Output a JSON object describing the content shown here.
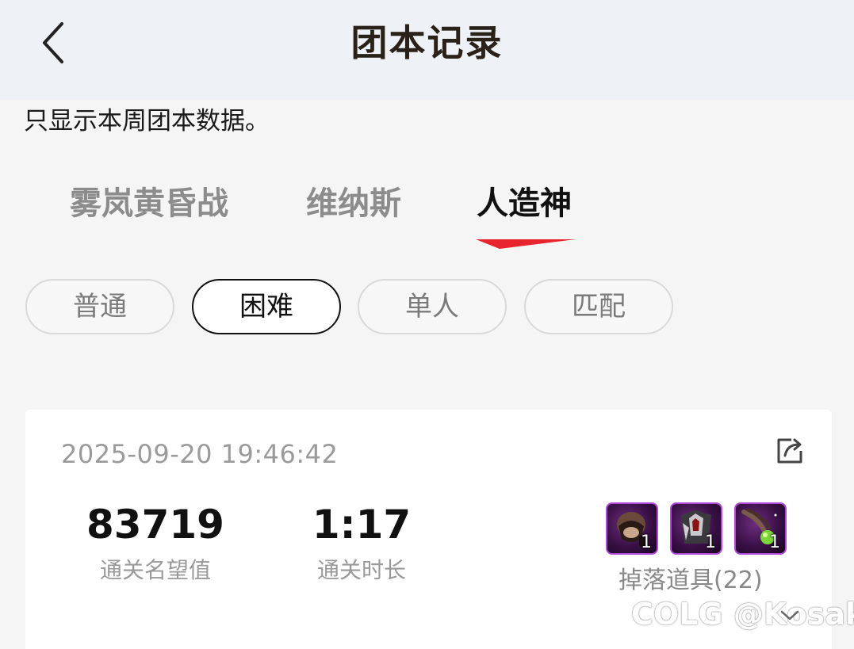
{
  "header": {
    "title": "团本记录",
    "back_icon": "chevron-left-icon"
  },
  "notice": "只显示本周团本数据。",
  "tabs": [
    {
      "label": "雾岚黄昏战",
      "active": false
    },
    {
      "label": "维纳斯",
      "active": false
    },
    {
      "label": "人造神",
      "active": true
    }
  ],
  "accent_color": "#e8242f",
  "difficulty": [
    {
      "label": "普通",
      "active": false
    },
    {
      "label": "困难",
      "active": true
    },
    {
      "label": "单人",
      "active": false
    },
    {
      "label": "匹配",
      "active": false
    }
  ],
  "record": {
    "timestamp": "2025-09-20 19:46:42",
    "share_icon": "share-icon",
    "fame_value": "83719",
    "fame_label": "通关名望值",
    "duration_value": "1:17",
    "duration_label": "通关时长",
    "drops": [
      {
        "icon": "dark-helmet-item-icon",
        "count": "1"
      },
      {
        "icon": "dark-armor-item-icon",
        "count": "1"
      },
      {
        "icon": "green-orb-item-icon",
        "count": "1"
      }
    ],
    "drops_label": "掉落道具(22)"
  },
  "watermark": {
    "text": "COLG @Kosaki"
  }
}
